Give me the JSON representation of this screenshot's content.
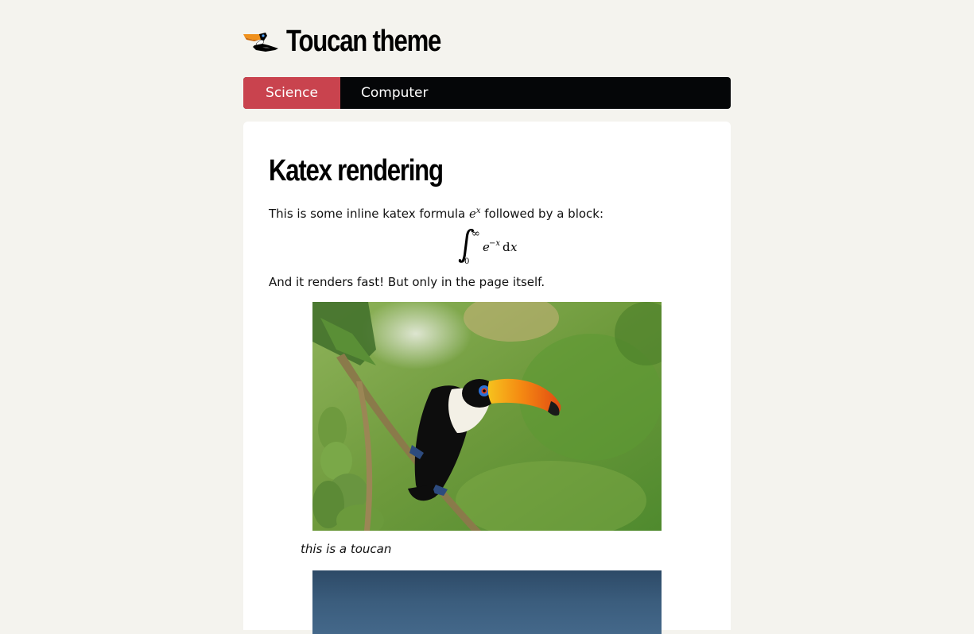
{
  "site": {
    "title": "Toucan theme"
  },
  "nav": {
    "items": [
      {
        "label": "Science",
        "active": true
      },
      {
        "label": "Computer",
        "active": false
      }
    ]
  },
  "post": {
    "title": "Katex rendering",
    "intro_before": "This is some inline katex formula ",
    "inline_formula_base": "e",
    "inline_formula_sup": "x",
    "intro_after": " followed by a block:",
    "block_formula": {
      "integral_upper": "∞",
      "integral_lower": "0",
      "base": "e",
      "exponent": "−x",
      "differential": "d",
      "variable": "x"
    },
    "outro": "And it renders fast! But only in the page itself.",
    "figure_caption": "this is a toucan"
  },
  "colors": {
    "background": "#f4f3ee",
    "nav_background": "#050608",
    "nav_active": "#c9434e",
    "card": "#ffffff"
  }
}
